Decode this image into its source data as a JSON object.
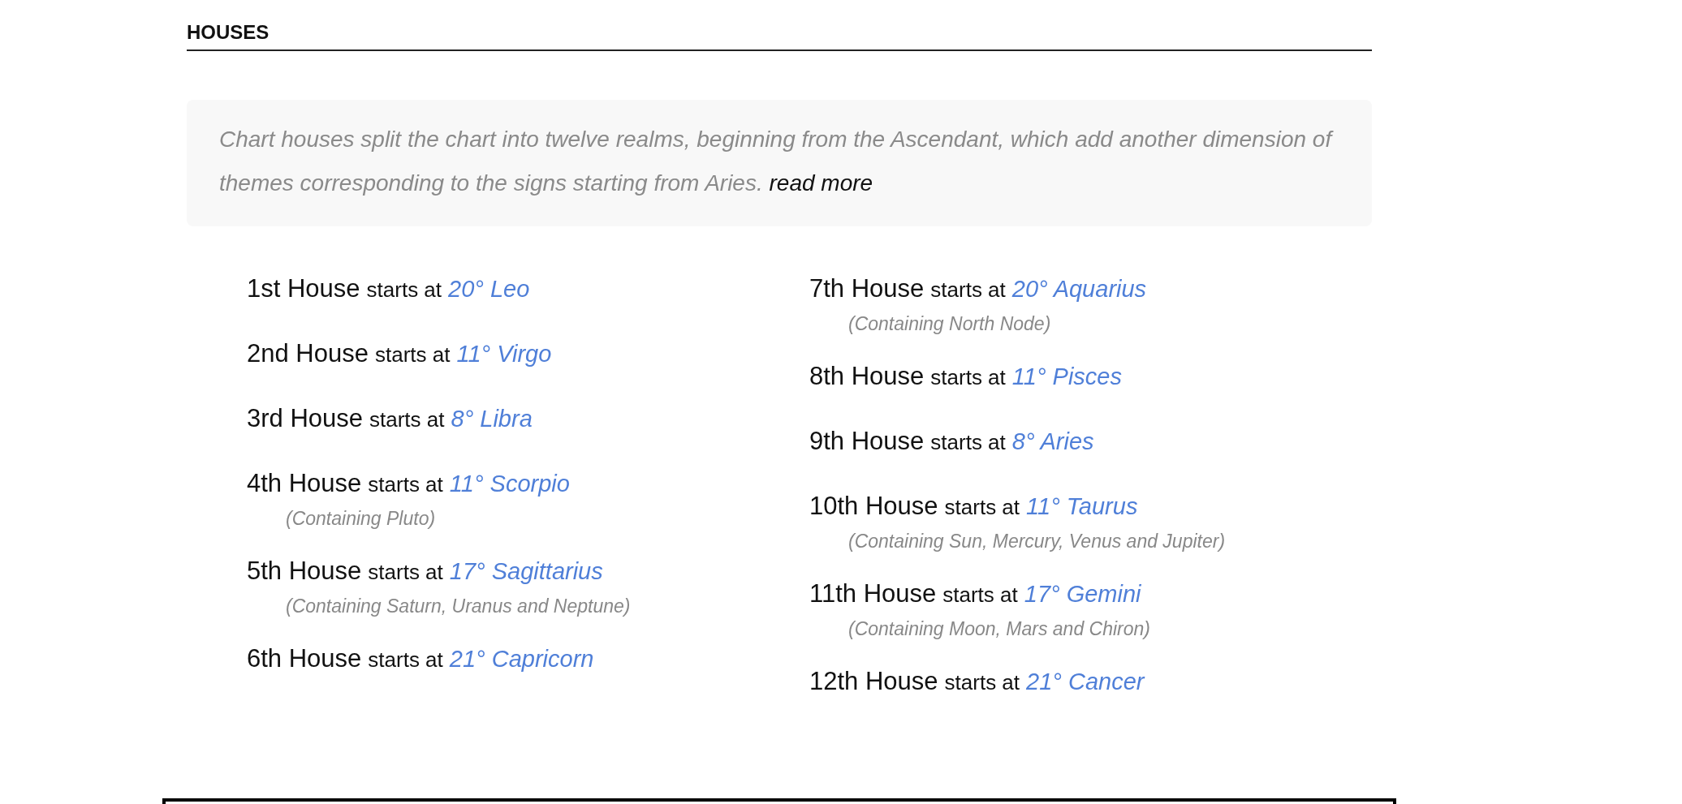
{
  "section": {
    "title": "HOUSES"
  },
  "intro": {
    "text": "Chart houses split the chart into twelve realms, beginning from the Ascendant, which add another dimension of themes corresponding to the signs starting from Aries.",
    "link": "read more"
  },
  "columns": [
    [
      {
        "house": "1st House",
        "starts": "starts at",
        "sign": "20° Leo"
      },
      {
        "house": "2nd House",
        "starts": "starts at",
        "sign": "11° Virgo"
      },
      {
        "house": "3rd House",
        "starts": "starts at",
        "sign": "8° Libra"
      },
      {
        "house": "4th House",
        "starts": "starts at",
        "sign": "11° Scorpio",
        "containing": "(Containing Pluto)"
      },
      {
        "house": "5th House",
        "starts": "starts at",
        "sign": "17° Sagittarius",
        "containing": "(Containing Saturn, Uranus and Neptune)"
      },
      {
        "house": "6th House",
        "starts": "starts at",
        "sign": "21° Capricorn"
      }
    ],
    [
      {
        "house": "7th House",
        "starts": "starts at",
        "sign": "20° Aquarius",
        "containing": "(Containing North Node)"
      },
      {
        "house": "8th House",
        "starts": "starts at",
        "sign": "11° Pisces"
      },
      {
        "house": "9th House",
        "starts": "starts at",
        "sign": "8° Aries"
      },
      {
        "house": "10th House",
        "starts": "starts at",
        "sign": "11° Taurus",
        "containing": "(Containing Sun, Mercury, Venus and Jupiter)"
      },
      {
        "house": "11th House",
        "starts": "starts at",
        "sign": "17° Gemini",
        "containing": "(Containing Moon, Mars and Chiron)"
      },
      {
        "house": "12th House",
        "starts": "starts at",
        "sign": "21° Cancer"
      }
    ]
  ]
}
